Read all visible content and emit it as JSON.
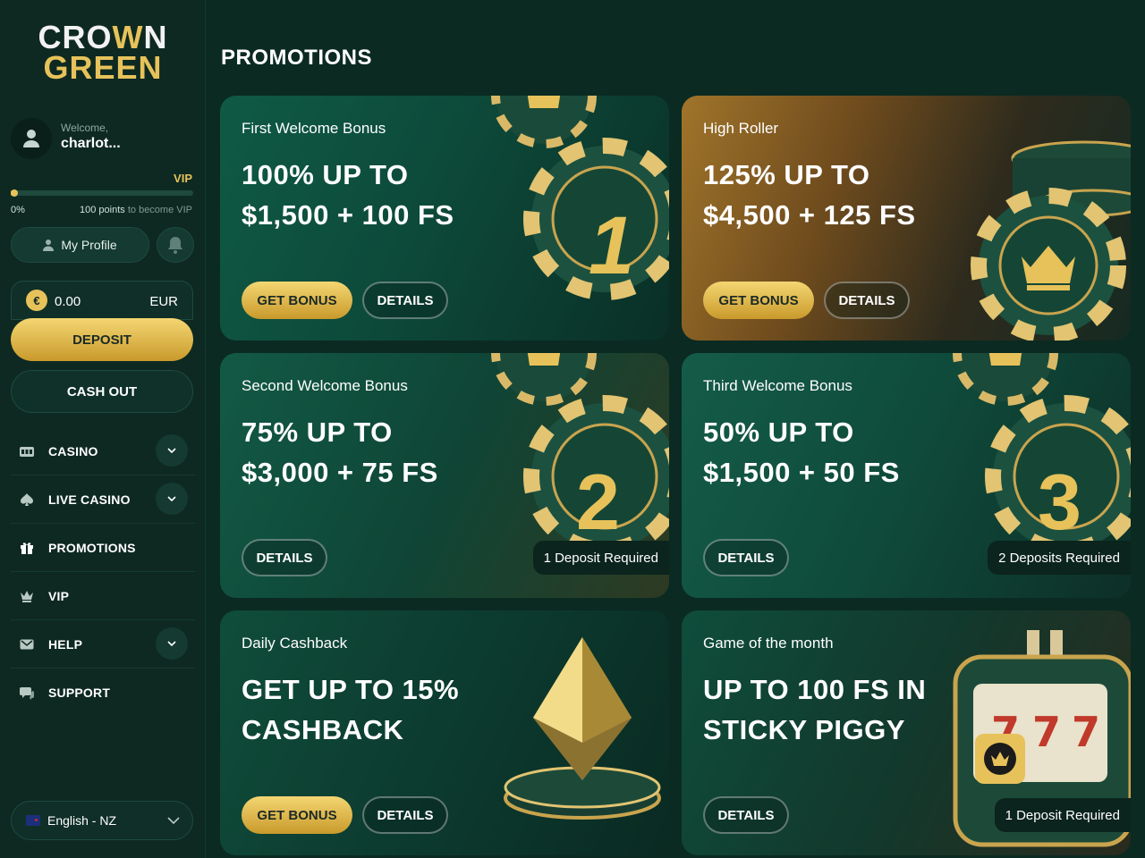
{
  "brand": {
    "line1_a": "CRO",
    "line1_crown": "W",
    "line1_b": "N",
    "line2": "GREEN"
  },
  "user": {
    "welcome": "Welcome,",
    "name": "charlot..."
  },
  "vip": {
    "label": "VIP",
    "progress_percent_text": "0%",
    "progress_fraction": 0.0,
    "points_strong": "100 points",
    "points_rest": "to become VIP"
  },
  "profile": {
    "label": "My Profile"
  },
  "balance": {
    "amount": "0.00",
    "currency": "EUR",
    "coin_symbol": "€"
  },
  "actions": {
    "deposit": "DEPOSIT",
    "cashout": "CASH OUT"
  },
  "nav": [
    {
      "label": "CASINO",
      "icon": "slot-icon",
      "has_chevron": true
    },
    {
      "label": "LIVE CASINO",
      "icon": "spade-icon",
      "has_chevron": true
    },
    {
      "label": "PROMOTIONS",
      "icon": "gift-icon",
      "has_chevron": false
    },
    {
      "label": "VIP",
      "icon": "crown-icon",
      "has_chevron": false
    },
    {
      "label": "HELP",
      "icon": "mail-icon",
      "has_chevron": true
    },
    {
      "label": "SUPPORT",
      "icon": "chat-icon",
      "has_chevron": false
    }
  ],
  "language": {
    "label": "English - NZ"
  },
  "page": {
    "title": "PROMOTIONS"
  },
  "promotions": [
    {
      "subtitle": "First Welcome Bonus",
      "line1": "100% UP TO",
      "line2": "$1,500 + 100 FS",
      "get_bonus": "GET BONUS",
      "details": "DETAILS",
      "chip_number": "1"
    },
    {
      "subtitle": "High Roller",
      "line1": "125% UP TO",
      "line2": "$4,500 + 125 FS",
      "get_bonus": "GET BONUS",
      "details": "DETAILS"
    },
    {
      "subtitle": "Second Welcome Bonus",
      "line1": "75% UP TO",
      "line2": "$3,000 + 75 FS",
      "details": "DETAILS",
      "requirement": "1 Deposit Required",
      "chip_number": "2"
    },
    {
      "subtitle": "Third Welcome Bonus",
      "line1": "50% UP TO",
      "line2": "$1,500 + 50 FS",
      "details": "DETAILS",
      "requirement": "2 Deposits Required",
      "chip_number": "3"
    },
    {
      "subtitle": "Daily Cashback",
      "line1": "GET UP TO 15%",
      "line2": "CASHBACK",
      "get_bonus": "GET BONUS",
      "details": "DETAILS"
    },
    {
      "subtitle": "Game of the month",
      "line1": "UP TO 100 FS IN",
      "line2": "STICKY PIGGY",
      "details": "DETAILS",
      "requirement": "1 Deposit Required"
    }
  ],
  "colors": {
    "accent_gold": "#e7c25a",
    "background": "#0b2a22",
    "sidebar": "#0e2922"
  }
}
